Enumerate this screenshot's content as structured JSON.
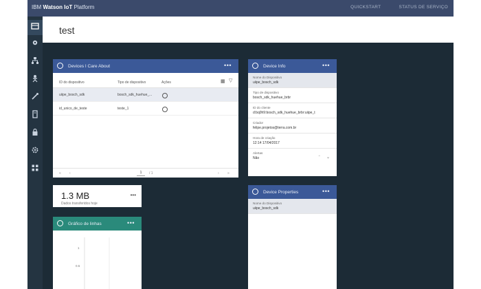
{
  "header": {
    "brand_prefix": "IBM",
    "brand_bold": "Watson IoT",
    "brand_suffix": "Platform",
    "nav": [
      "QUICKSTART",
      "STATUS DE SERVIÇO"
    ]
  },
  "sidebar": {
    "items": [
      "boards-icon",
      "gear-icon",
      "devices-icon",
      "members-icon",
      "rules-icon",
      "reports-icon",
      "security-icon",
      "settings-icon",
      "extensions-icon"
    ]
  },
  "page": {
    "title": "test"
  },
  "devices_card": {
    "title": "Devices I Care About",
    "more": "•••",
    "columns": [
      "ID do dispositivo",
      "Tipo de dispositivo",
      "Ações"
    ],
    "rows": [
      {
        "id": "uiipe_bosch_sdk",
        "type": "bosch_sdk_huehue_..."
      },
      {
        "id": "id_unico_de_teste",
        "type": "teste_1"
      }
    ],
    "pager": {
      "page": "1",
      "total": "/ 1"
    }
  },
  "device_info": {
    "title": "Device Info",
    "more": "•••",
    "fields": [
      {
        "label": "Nome do Dispositivo",
        "value": "uiipe_bosch_sdk"
      },
      {
        "label": "Tipo de dispositivo",
        "value": "bosch_sdk_huehue_brbr"
      },
      {
        "label": "ID do cliente",
        "value": "d:bq0h9:bosch_sdk_huehue_brbr:uiipe_t"
      },
      {
        "label": "Criador",
        "value": "felipe.projetos@terra.com.br"
      },
      {
        "label": "Hora de criação",
        "value": "12:14 17/04/2017"
      },
      {
        "label": "Alertas",
        "value": "Não"
      }
    ]
  },
  "stat_card": {
    "value": "1.3 MB",
    "label": "Dados transferidos hoje",
    "more": "•••"
  },
  "chart_card": {
    "title": "Gráfico de linhas",
    "more": "•••",
    "ticks": [
      "1",
      "0.5"
    ]
  },
  "device_props": {
    "title": "Device Properties",
    "more": "•••",
    "fields": [
      {
        "label": "Nome do Dispositivo",
        "value": "uiipe_bosch_sdk"
      }
    ]
  },
  "colors": {
    "topbar": "#3b4a6b",
    "card_header": "#3b5998",
    "chart_header": "#2a8a7b",
    "background": "#1c2b36"
  }
}
